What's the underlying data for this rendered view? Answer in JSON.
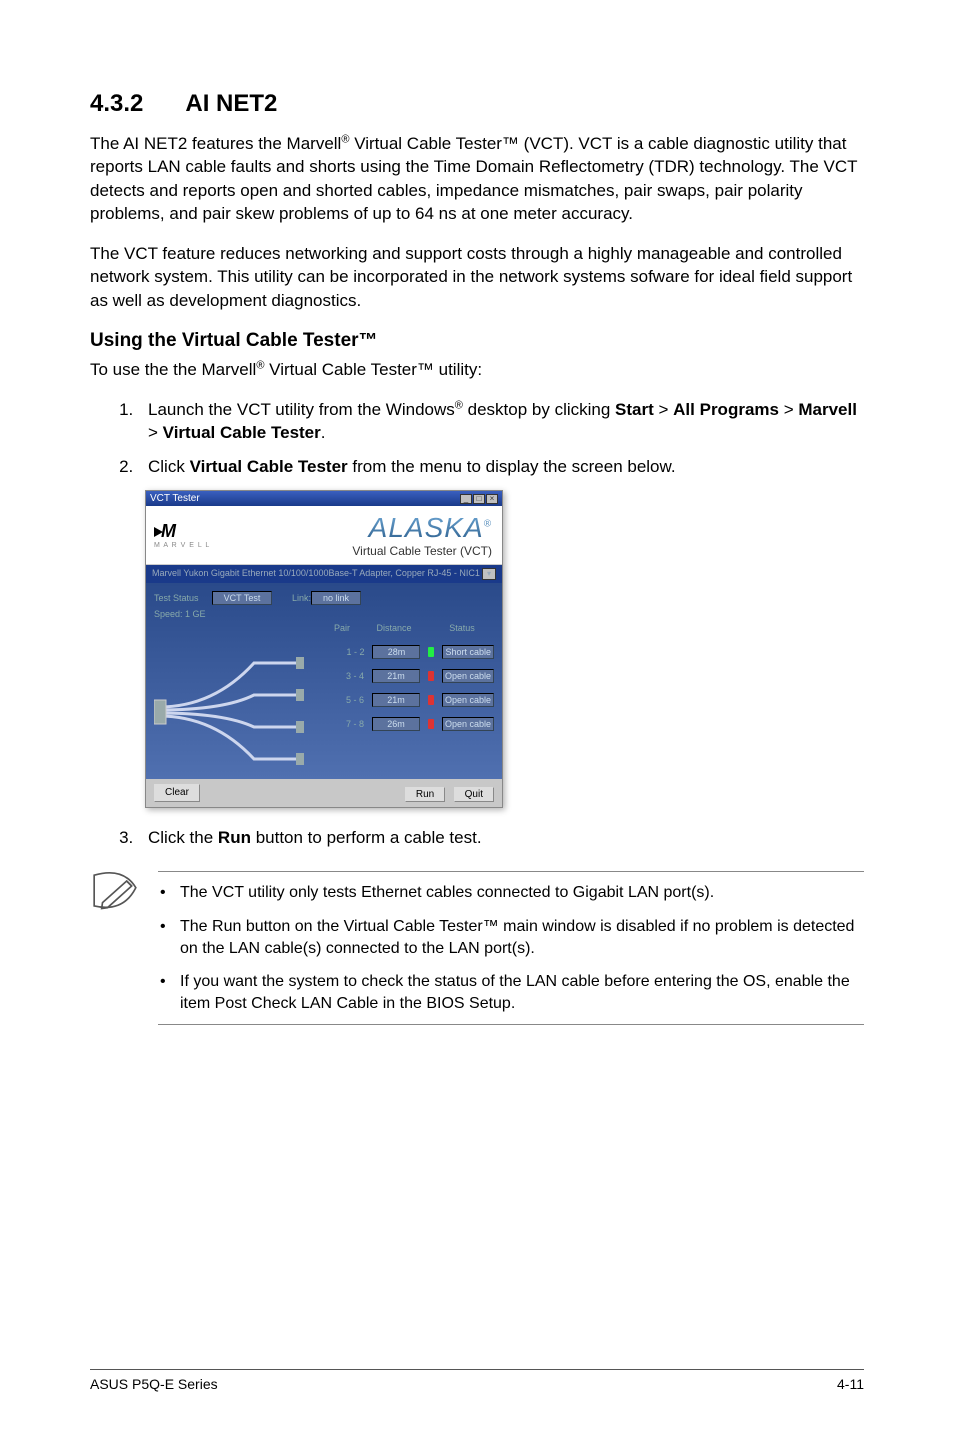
{
  "heading": {
    "num": "4.3.2",
    "title": "AI NET2"
  },
  "para1_parts": {
    "a": "The AI NET2 features the Marvell",
    "b": " Virtual Cable Tester™ (VCT). VCT is a cable diagnostic utility that reports LAN cable faults and shorts using the Time Domain Reflectometry (TDR) technology. The VCT detects and reports open and shorted cables, impedance mismatches, pair swaps, pair polarity problems, and pair skew problems of up to 64 ns at one meter accuracy."
  },
  "para2": "The VCT feature reduces networking and support costs through a highly manageable and controlled network system. This utility can be incorporated in the network systems sofware for ideal field support as well as development diagnostics.",
  "subheading": "Using the Virtual Cable Tester™",
  "subline_parts": {
    "a": "To use the the Marvell",
    "b": " Virtual Cable Tester™  utility:"
  },
  "step1_parts": {
    "a": "Launch the VCT utility from the Windows",
    "b": " desktop by clicking ",
    "start": "Start",
    "gt1": " > ",
    "allprog": "All Programs",
    "gt2": " > ",
    "marvell": "Marvell",
    "gt3": " > ",
    "vct": "Virtual Cable Tester",
    "end": "."
  },
  "step2_parts": {
    "a": "Click ",
    "b": "Virtual Cable Tester",
    "c": " from the menu to display the screen below."
  },
  "step3_parts": {
    "a": "Click the ",
    "b": "Run",
    "c": " button to perform a cable test."
  },
  "notes": [
    "The VCT utility only tests Ethernet cables connected to Gigabit LAN port(s).",
    "The Run button on the Virtual Cable Tester™ main window is disabled if no problem is detected on the LAN cable(s) connected to the LAN port(s).",
    "If you want the system to check the status of the LAN cable before entering the OS, enable the item Post Check LAN Cable in the BIOS Setup."
  ],
  "vct": {
    "titlebar": "VCT Tester",
    "marvell_small": "M A R V E L L",
    "alaska": "ALASKA",
    "alaska_reg": "®",
    "vct_label": "Virtual Cable Tester (VCT)",
    "dropdown": "Marvell Yukon Gigabit Ethernet 10/100/1000Base-T Adapter, Copper RJ-45 - NIC1",
    "test_status_lbl": "Test Status",
    "test_status_val": "VCT Test",
    "speed_lbl": "Speed: 1 GE",
    "link_lbl": "Link:",
    "link_val": "no link",
    "col_pair": "Pair",
    "col_dist": "Distance",
    "col_status": "Status",
    "rows": [
      {
        "pair": "1 - 2",
        "dist": "28m",
        "status": "Short cable",
        "bad": false
      },
      {
        "pair": "3 - 4",
        "dist": "21m",
        "status": "Open cable",
        "bad": true
      },
      {
        "pair": "5 - 6",
        "dist": "21m",
        "status": "Open cable",
        "bad": true
      },
      {
        "pair": "7 - 8",
        "dist": "26m",
        "status": "Open cable",
        "bad": true
      }
    ],
    "btn_clear": "Clear",
    "btn_run": "Run",
    "btn_quit": "Quit"
  },
  "footer": {
    "left": "ASUS P5Q-E Series",
    "right": "4-11"
  }
}
